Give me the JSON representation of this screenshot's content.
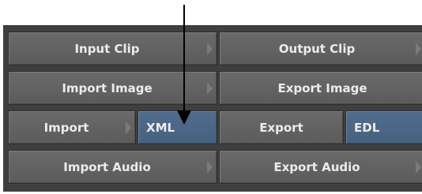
{
  "row1": {
    "input_clip": "Input Clip",
    "output_clip": "Output Clip"
  },
  "row2": {
    "import_image": "Import Image",
    "export_image": "Export Image"
  },
  "row3": {
    "import": "Import",
    "import_format": "XML",
    "export": "Export",
    "export_format": "EDL"
  },
  "row4": {
    "import_audio": "Import Audio",
    "export_audio": "Export Audio"
  },
  "colors": {
    "button": "#5f5f5f",
    "selected_field": "#4a6584",
    "panel": "#3f3f3f",
    "text": "#ececec",
    "pointer": "#000000"
  },
  "pointer_icon": "callout-arrow-icon"
}
